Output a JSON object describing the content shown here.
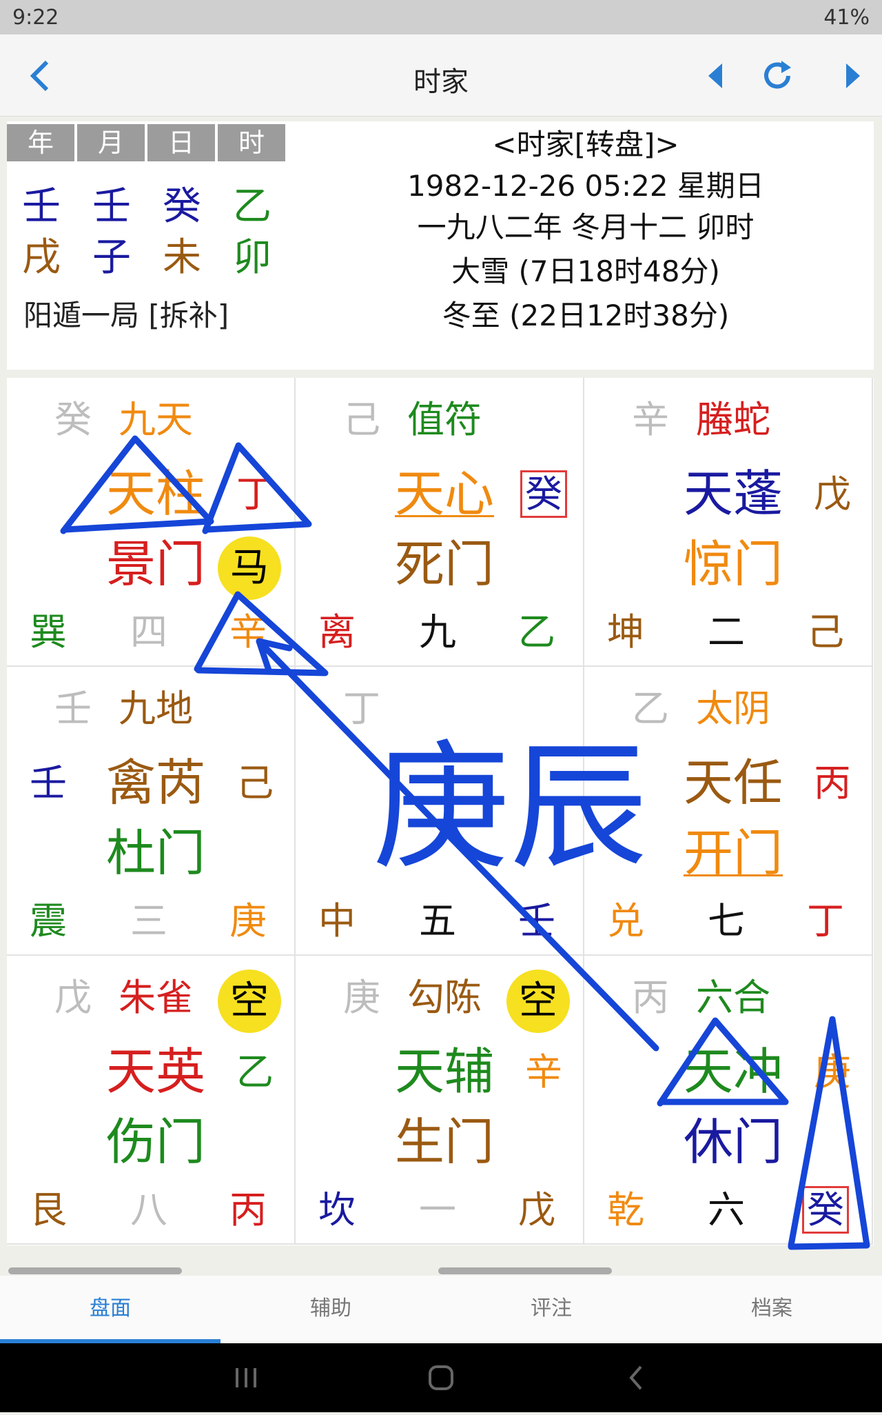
{
  "status": {
    "time": "9:22",
    "right": "41%"
  },
  "app": {
    "title": "时家"
  },
  "info": {
    "pillar_heads": [
      "年",
      "月",
      "日",
      "时"
    ],
    "stems": [
      {
        "text": "壬",
        "color": "#1a1aa0"
      },
      {
        "text": "壬",
        "color": "#1a1aa0"
      },
      {
        "text": "癸",
        "color": "#1a1aa0"
      },
      {
        "text": "乙",
        "color": "#1e8a1e"
      }
    ],
    "branches": [
      {
        "text": "戌",
        "color": "#9a5a12"
      },
      {
        "text": "子",
        "color": "#1a1aa0"
      },
      {
        "text": "未",
        "color": "#9a5a12"
      },
      {
        "text": "卯",
        "color": "#1e8a1e"
      }
    ],
    "ju": "阳遁一局 [拆补]",
    "lines": [
      "<时家[转盘]>",
      "1982-12-26 05:22 星期日",
      "一九八二年 冬月十二 卯时",
      "大雪 (7日18时48分)",
      "冬至 (22日12时38分)"
    ]
  },
  "palaces": [
    {
      "name": "巽",
      "num": "四",
      "tl": "癸",
      "god": "九天",
      "star": "天柱",
      "sg": "丁",
      "door": "景门",
      "lg": "辛",
      "mark": "马",
      "c": {
        "name": "#1e8a1e",
        "num": "#bdbdbd",
        "tl": "#bdbdbd",
        "god": "#f08a10",
        "star": "#f08a10",
        "sg": "#d61f1f",
        "door": "#d61f1f",
        "lg": "#f08a10"
      }
    },
    {
      "name": "离",
      "num": "九",
      "tl": "己",
      "god": "值符",
      "star": "天心",
      "sg": "癸",
      "door": "死门",
      "lg": "乙",
      "mark": "",
      "c": {
        "name": "#d61f1f",
        "num": "#111111",
        "tl": "#bdbdbd",
        "god": "#1e8a1e",
        "star": "#f08a10",
        "sg": "#1a1aa0",
        "door": "#9a5a12",
        "lg": "#1e8a1e"
      }
    },
    {
      "name": "坤",
      "num": "二",
      "tl": "辛",
      "god": "螣蛇",
      "star": "天蓬",
      "sg": "戊",
      "door": "惊门",
      "lg": "己",
      "mark": "",
      "c": {
        "name": "#9a5a12",
        "num": "#111111",
        "tl": "#bdbdbd",
        "god": "#d61f1f",
        "star": "#1a1aa0",
        "sg": "#9a5a12",
        "door": "#f08a10",
        "lg": "#9a5a12"
      }
    },
    {
      "name": "震",
      "num": "三",
      "tl": "壬",
      "god": "九地",
      "star": "禽芮",
      "sg": "己",
      "door": "杜门",
      "lg": "庚",
      "left": "壬",
      "mark": "",
      "c": {
        "name": "#1e8a1e",
        "num": "#bdbdbd",
        "tl": "#bdbdbd",
        "god": "#9a5a12",
        "star": "#9a5a12",
        "sg": "#9a5a12",
        "door": "#1e8a1e",
        "lg": "#f08a10",
        "left": "#1a1aa0"
      }
    },
    {
      "name": "中",
      "num": "五",
      "tl": "丁",
      "god": "",
      "star": "",
      "sg": "",
      "door": "",
      "lg": "壬",
      "mark": "",
      "c": {
        "name": "#9a5a12",
        "num": "#111111",
        "tl": "#bdbdbd",
        "lg": "#1a1aa0"
      }
    },
    {
      "name": "兑",
      "num": "七",
      "tl": "乙",
      "god": "太阴",
      "star": "天任",
      "sg": "丙",
      "door": "开门",
      "lg": "丁",
      "mark": "",
      "c": {
        "name": "#f08a10",
        "num": "#111111",
        "tl": "#bdbdbd",
        "god": "#f08a10",
        "star": "#9a5a12",
        "sg": "#d61f1f",
        "door": "#f08a10",
        "lg": "#d61f1f"
      }
    },
    {
      "name": "艮",
      "num": "八",
      "tl": "戊",
      "god": "朱雀",
      "star": "天英",
      "sg": "乙",
      "door": "伤门",
      "lg": "丙",
      "mark": "空",
      "c": {
        "name": "#9a5a12",
        "num": "#bdbdbd",
        "tl": "#bdbdbd",
        "god": "#d61f1f",
        "star": "#d61f1f",
        "sg": "#1e8a1e",
        "door": "#1e8a1e",
        "lg": "#d61f1f"
      }
    },
    {
      "name": "坎",
      "num": "一",
      "tl": "庚",
      "god": "勾陈",
      "star": "天辅",
      "sg": "辛",
      "door": "生门",
      "lg": "戊",
      "mark": "空",
      "c": {
        "name": "#1a1aa0",
        "num": "#bdbdbd",
        "tl": "#bdbdbd",
        "god": "#9a5a12",
        "star": "#1e8a1e",
        "sg": "#f08a10",
        "door": "#9a5a12",
        "lg": "#9a5a12"
      }
    },
    {
      "name": "乾",
      "num": "六",
      "tl": "丙",
      "god": "六合",
      "star": "天冲",
      "sg": "庚",
      "door": "休门",
      "lg": "癸",
      "mark": "",
      "c": {
        "name": "#f08a10",
        "num": "#111111",
        "tl": "#bdbdbd",
        "god": "#1e8a1e",
        "star": "#1e8a1e",
        "sg": "#f08a10",
        "door": "#1a1aa0",
        "lg": "#1a1aa0"
      }
    }
  ],
  "handwriting": {
    "text": "庚辰",
    "color": "#1646d8"
  },
  "tabs": [
    "盘面",
    "辅助",
    "评注",
    "档案"
  ]
}
